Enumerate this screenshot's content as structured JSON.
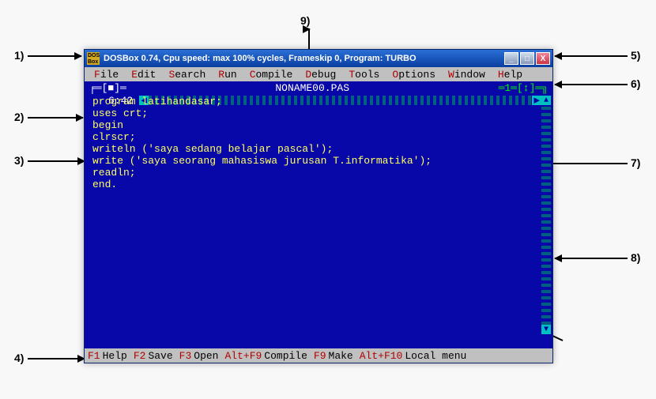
{
  "annotations": {
    "a1": "1)",
    "a2": "2)",
    "a3": "3)",
    "a4": "4)",
    "a5": "5)",
    "a6": "6)",
    "a7": "7)",
    "a8": "8)",
    "a9": "9)"
  },
  "titlebar": {
    "text": "DOSBox 0.74, Cpu speed: max 100% cycles, Frameskip  0, Program:    TURBO",
    "icon_label": "DOS Box"
  },
  "menu": {
    "file": "ile",
    "edit": "dit",
    "search": "earch",
    "run": "un",
    "compile": "ompile",
    "debug": "ebug",
    "tools": "ools",
    "options": "ptions",
    "window": "indow",
    "help": "elp",
    "hotkeys": {
      "file": "F",
      "edit": "E",
      "search": "S",
      "run": "R",
      "compile": "C",
      "debug": "D",
      "tools": "T",
      "options": "O",
      "window": "W",
      "help": "H"
    }
  },
  "editor": {
    "frame_left": "╒═[■]═",
    "filename": " NONAME00.PAS ",
    "frame_right": "═1═[↕]═╗",
    "cursor_pos": "6:42",
    "scroll_left": "◄",
    "scroll_right": "►",
    "scroll_up": "▲",
    "scroll_down": "▼",
    "code_lines": [
      "program latihandasar;",
      "uses crt;",
      "begin",
      "clrscr;",
      "writeln ('saya sedang belajar pascal');",
      "write ('saya seorang mahasiswa jurusan T.informatika');",
      "readln;",
      "end."
    ]
  },
  "statusbar": {
    "items": [
      {
        "key": "F1",
        "label": "Help"
      },
      {
        "key": "F2",
        "label": "Save"
      },
      {
        "key": "F3",
        "label": "Open"
      },
      {
        "key": "Alt+F9",
        "label": "Compile"
      },
      {
        "key": "F9",
        "label": "Make"
      },
      {
        "key": "Alt+F10",
        "label": "Local menu"
      }
    ]
  },
  "winbuttons": {
    "min": "_",
    "max": "□",
    "close": "X"
  }
}
